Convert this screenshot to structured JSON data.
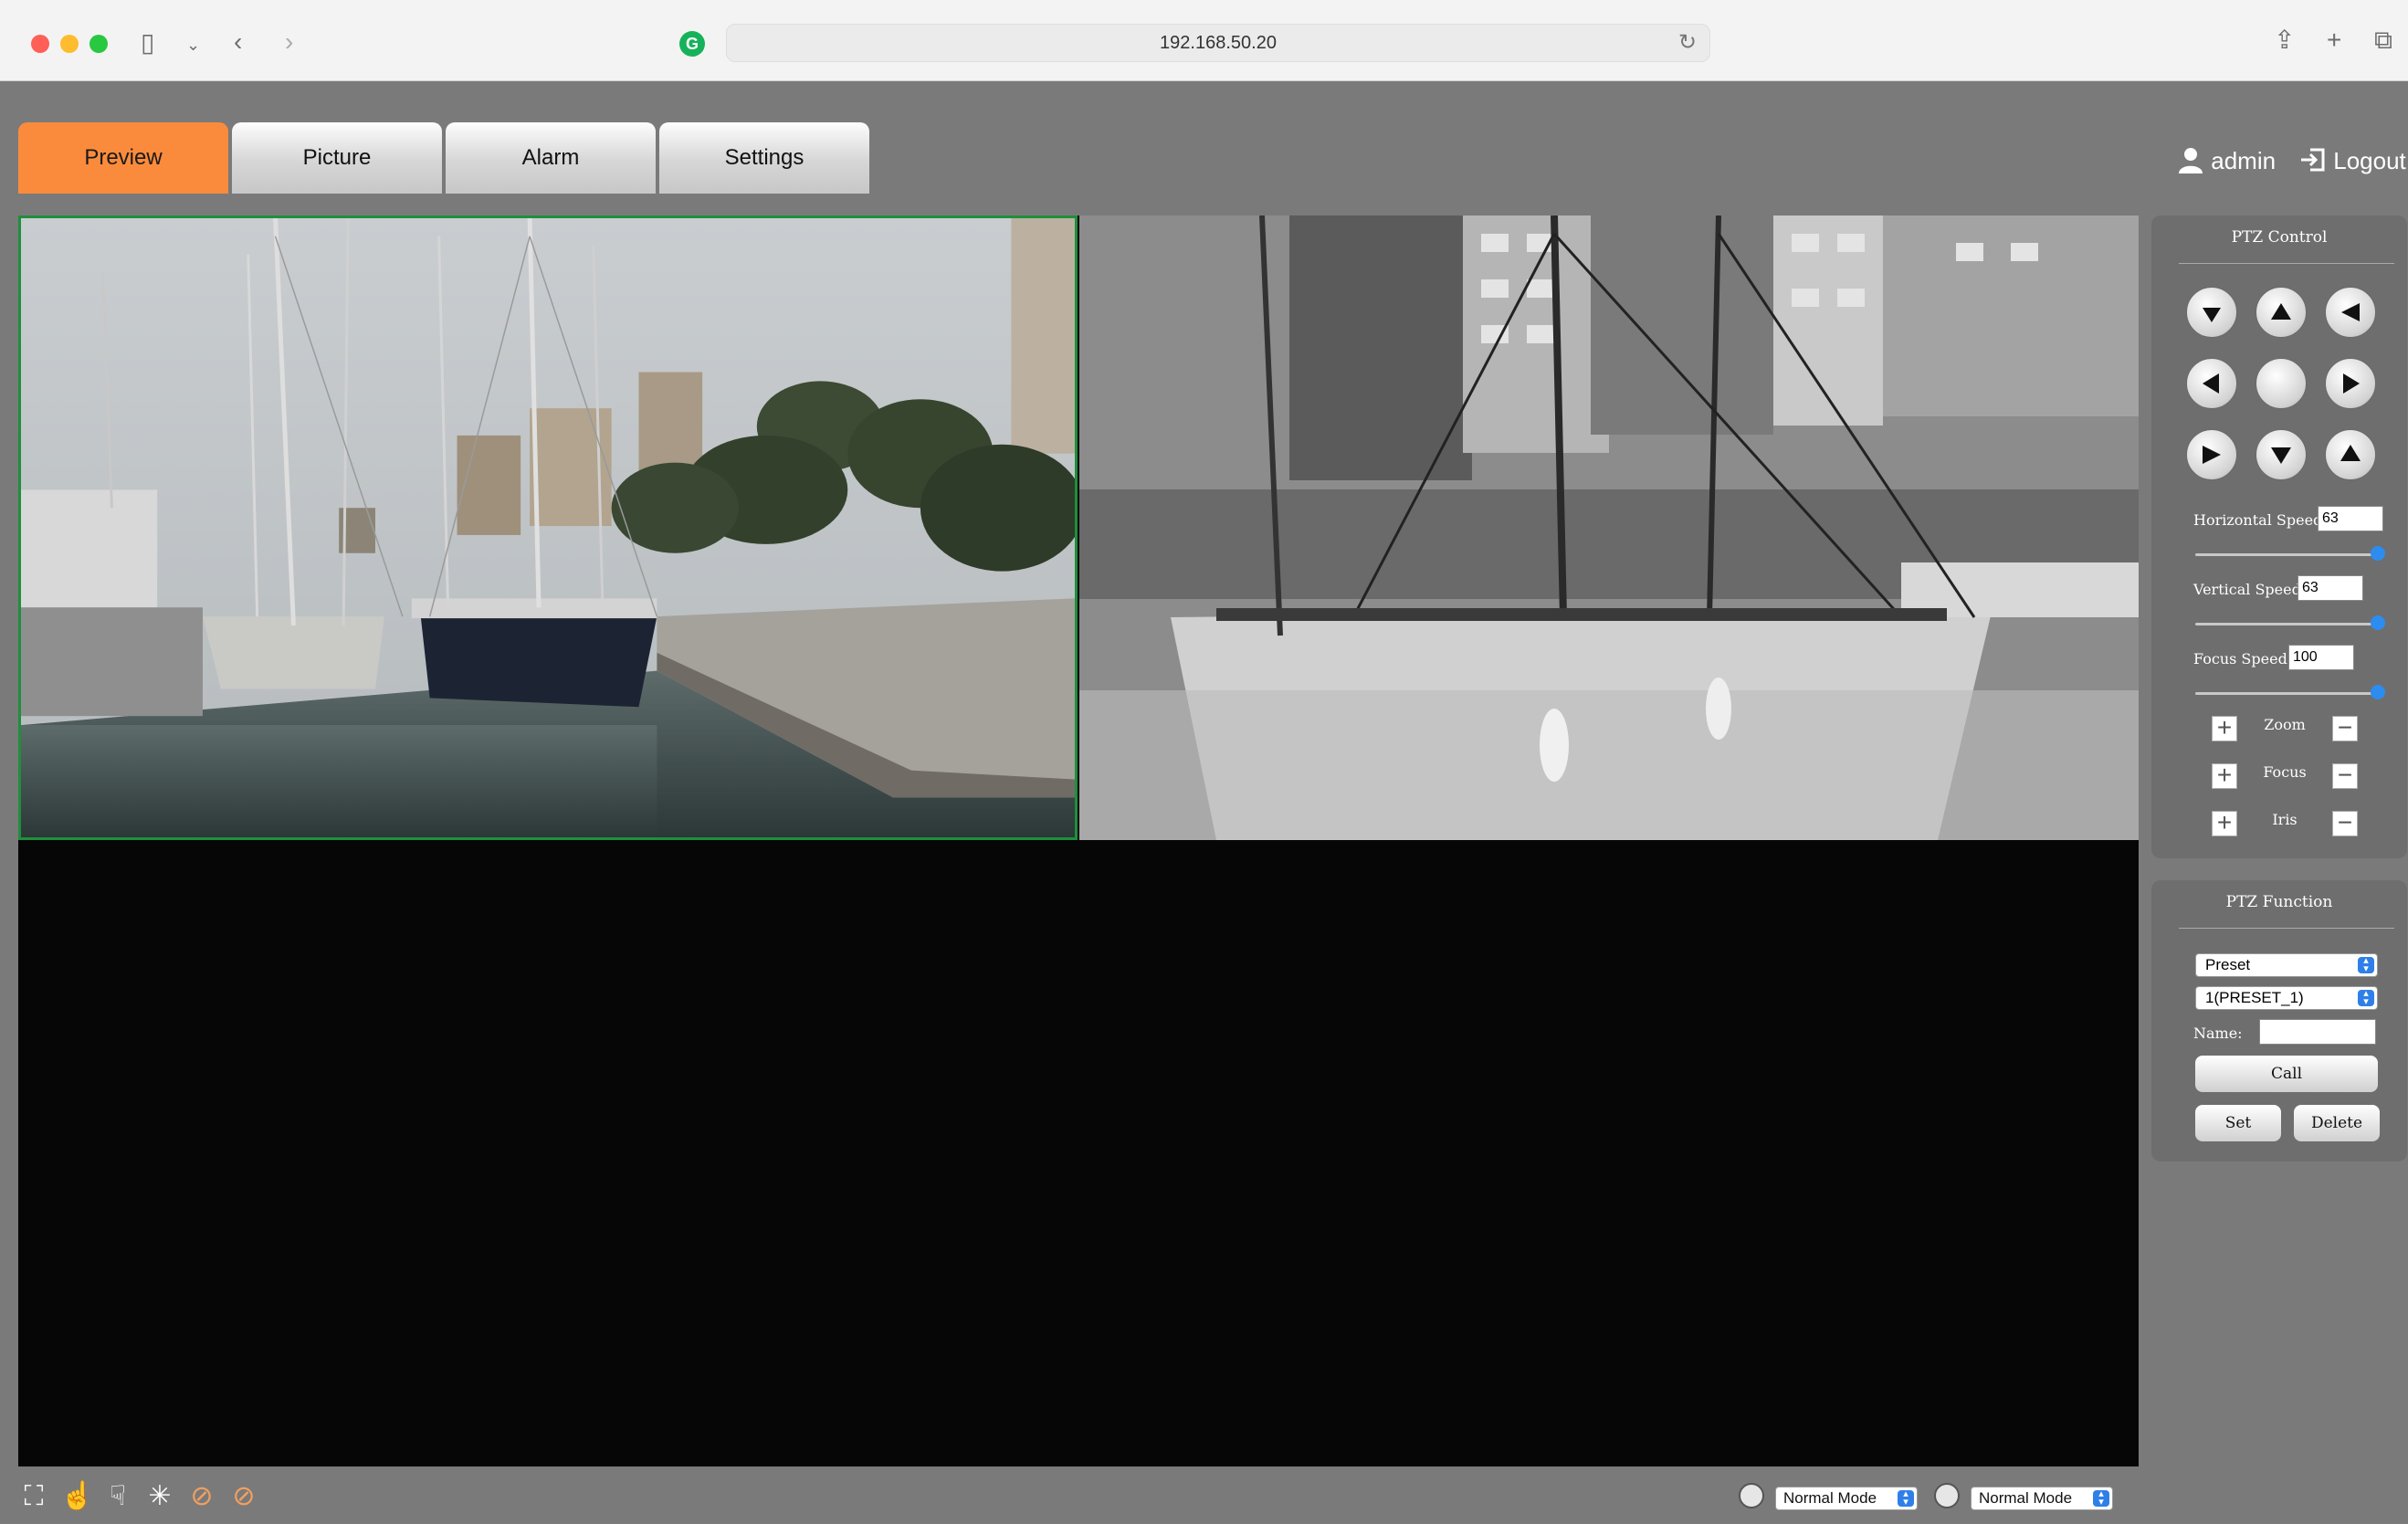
{
  "browser": {
    "url": "192.168.50.20"
  },
  "tabs": [
    {
      "label": "Preview"
    },
    {
      "label": "Picture"
    },
    {
      "label": "Alarm"
    },
    {
      "label": "Settings"
    }
  ],
  "user": {
    "name": "admin",
    "logout_label": "Logout"
  },
  "ptz_control": {
    "title": "PTZ Control",
    "horizontal_speed_label": "Horizontal Speed",
    "horizontal_speed_value": "63",
    "vertical_speed_label": "Vertical Speed",
    "vertical_speed_value": "63",
    "focus_speed_label": "Focus Speed:",
    "focus_speed_value": "100",
    "zoom_label": "Zoom",
    "focus_label": "Focus",
    "iris_label": "Iris"
  },
  "ptz_function": {
    "title": "PTZ Function",
    "mode_select": "Preset",
    "preset_select": "1(PRESET_1)",
    "name_label": "Name:",
    "name_value": "",
    "call_label": "Call",
    "set_label": "Set",
    "delete_label": "Delete"
  },
  "bottom": {
    "mode1": "Normal Mode",
    "mode2": "Normal Mode"
  },
  "colors": {
    "active_tab": "#fb8b3c",
    "selection_border": "#1f8f3c",
    "slider_thumb": "#2d8cf0"
  }
}
